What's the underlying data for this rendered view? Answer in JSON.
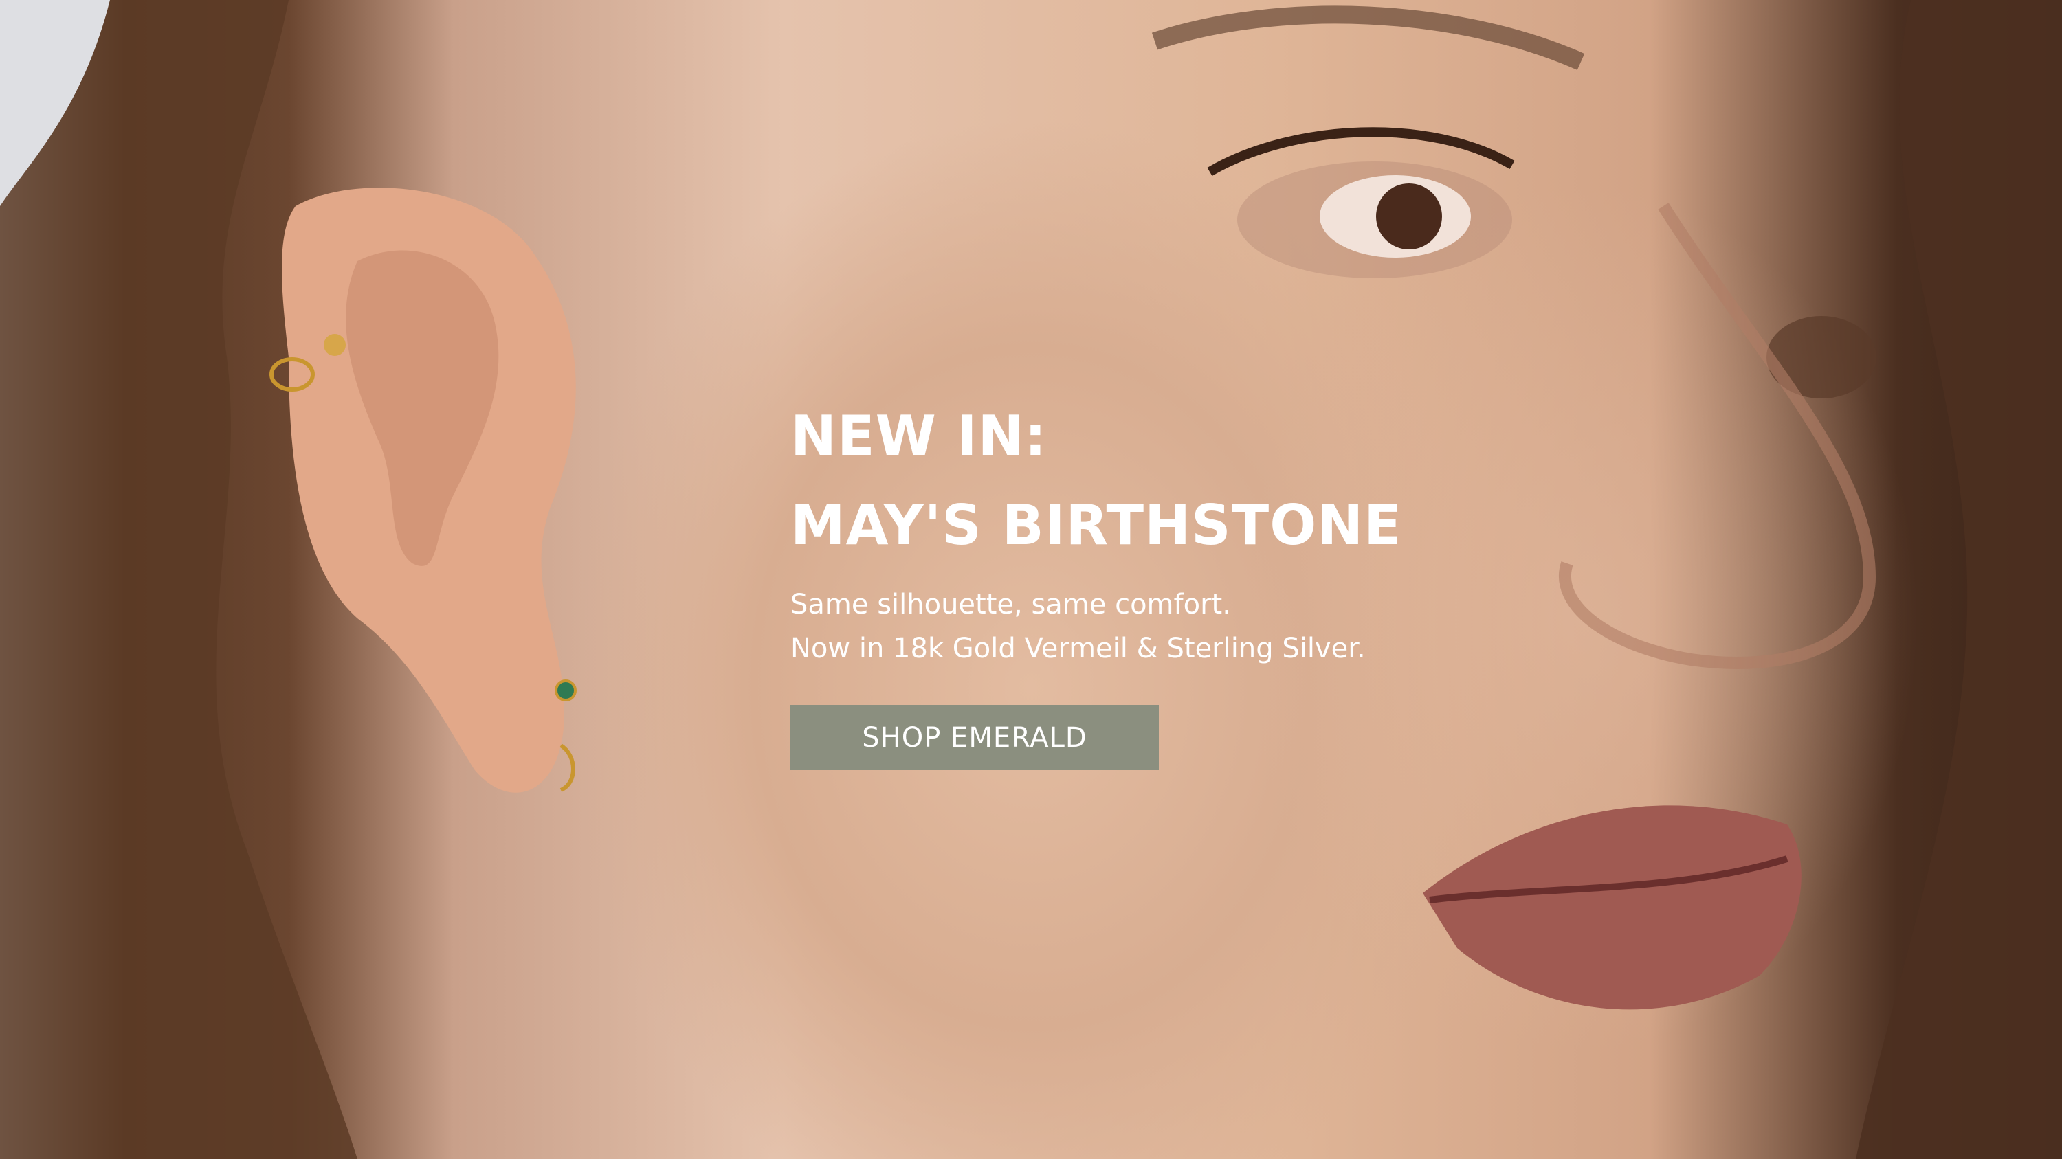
{
  "hero": {
    "headline_line1": "NEW IN:",
    "headline_line2": "MAY'S BIRTHSTONE",
    "subline_line1": "Same silhouette, same comfort.",
    "subline_line2": "Now in 18k Gold Vermeil & Sterling Silver.",
    "cta_label": "SHOP EMERALD"
  },
  "colors": {
    "cta_background": "#8b8f7f",
    "text": "#ffffff"
  }
}
